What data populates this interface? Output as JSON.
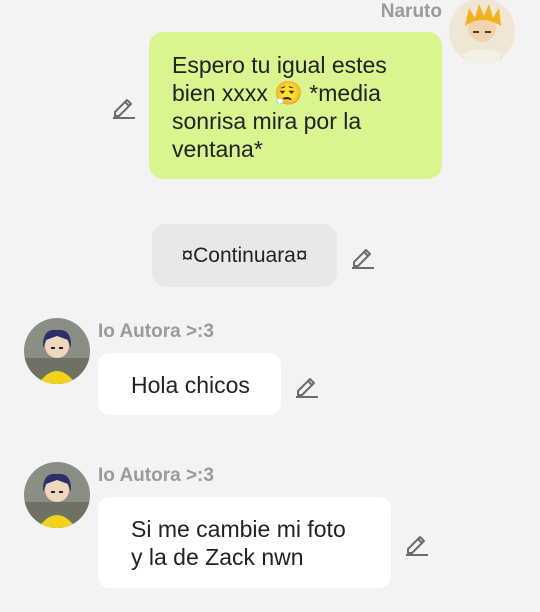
{
  "messages": [
    {
      "sender": "Naruto",
      "text_lines": [
        "Espero tu igual estes",
        "bien xxxx",
        "*media",
        "sonrisa mira por la",
        "ventana*"
      ],
      "emoji": "😮‍💨"
    },
    {
      "text": "¤Continuara¤"
    },
    {
      "sender": "Io Autora >:3",
      "text": "Hola chicos"
    },
    {
      "sender": "Io Autora >:3",
      "text_lines": [
        "Si me cambie mi foto",
        "y la de Zack nwn"
      ]
    }
  ],
  "icons": {
    "edit": "pencil-edit-icon",
    "avatar_naruto": "blonde-character-avatar",
    "avatar_author": "dark-haired-character-avatar"
  },
  "colors": {
    "background": "#f3f3f3",
    "outgoing_bubble": "#d8f58f",
    "incoming_bubble": "#ffffff",
    "system_bubble": "#e8e8e8",
    "name_text": "#9a9a9a"
  }
}
